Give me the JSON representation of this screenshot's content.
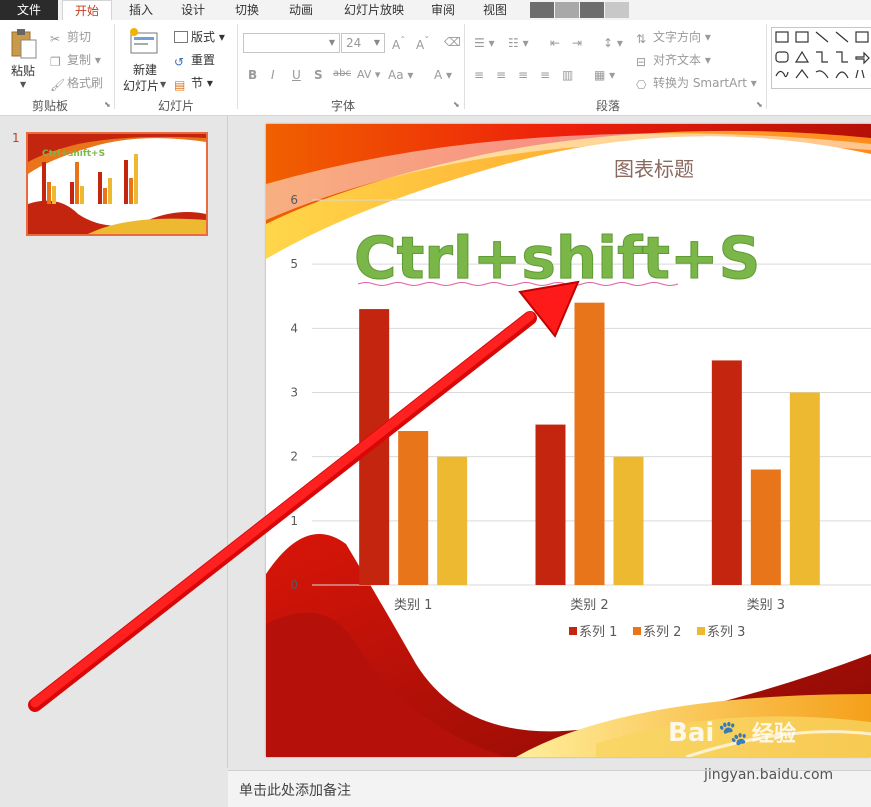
{
  "tabs": [
    {
      "label": "文件"
    },
    {
      "label": "开始"
    },
    {
      "label": "插入"
    },
    {
      "label": "设计"
    },
    {
      "label": "切换"
    },
    {
      "label": "动画"
    },
    {
      "label": "幻灯片放映"
    },
    {
      "label": "审阅"
    },
    {
      "label": "视图"
    }
  ],
  "ribbon": {
    "clipboard": {
      "paste": "粘贴",
      "cut": "剪切",
      "copy": "复制",
      "format_painter": "格式刷",
      "group": "剪贴板"
    },
    "slides": {
      "new_slide_1": "新建",
      "new_slide_2": "幻灯片",
      "layout": "版式",
      "reset": "重置",
      "section": "节",
      "group": "幻灯片"
    },
    "font": {
      "size": "24",
      "group": "字体"
    },
    "paragraph": {
      "text_direction": "文字方向",
      "align_text": "对齐文本",
      "smartart": "转换为 SmartArt",
      "group": "段落"
    }
  },
  "thumbnail": {
    "number": "1",
    "text": "Ctrl+shift+S"
  },
  "slide": {
    "overlay_text": "Ctrl+shift+S"
  },
  "colors": {
    "series1": "#c4250f",
    "series2": "#e8751a",
    "series3": "#ecb931",
    "overlay_green": "#7ab648",
    "arrow": "#ee1111"
  },
  "chart_data": {
    "type": "bar",
    "title": "图表标题",
    "categories": [
      "类别 1",
      "类别 2",
      "类别 3"
    ],
    "series": [
      {
        "name": "系列 1",
        "values": [
          4.3,
          2.5,
          3.5
        ]
      },
      {
        "name": "系列 2",
        "values": [
          2.4,
          4.4,
          1.8
        ]
      },
      {
        "name": "系列 3",
        "values": [
          2,
          2,
          3
        ]
      }
    ],
    "yticks": [
      "0",
      "1",
      "2",
      "3",
      "4",
      "5",
      "6"
    ],
    "ylim": [
      0,
      6
    ],
    "grid": true,
    "legend": "bottom"
  },
  "notes": {
    "placeholder": "单击此处添加备注"
  },
  "watermark": {
    "brand": "Bai",
    "brand2": "经验",
    "url": "jingyan.baidu.com"
  }
}
